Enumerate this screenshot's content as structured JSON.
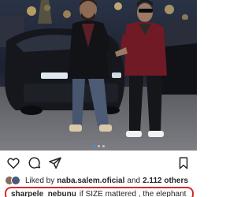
{
  "post": {
    "photo": {
      "description_icon": "photo-of-two-men-by-car"
    },
    "carousel": {
      "count": 3,
      "active_index": 0
    }
  },
  "actions": {
    "like_icon": "heart-icon",
    "comment_icon": "comment-icon",
    "share_icon": "send-icon",
    "save_icon": "bookmark-icon"
  },
  "likes": {
    "prefix": "Liked by",
    "user": "naba.salem.oficial",
    "conjunction": "and",
    "others": "2.112 others"
  },
  "caption": {
    "username": "sharpele_nebunu",
    "text": "if SIZE mattered , the elephant"
  },
  "colors": {
    "accent": "#3897f0",
    "highlight": "#d62a2a",
    "text": "#262626"
  }
}
